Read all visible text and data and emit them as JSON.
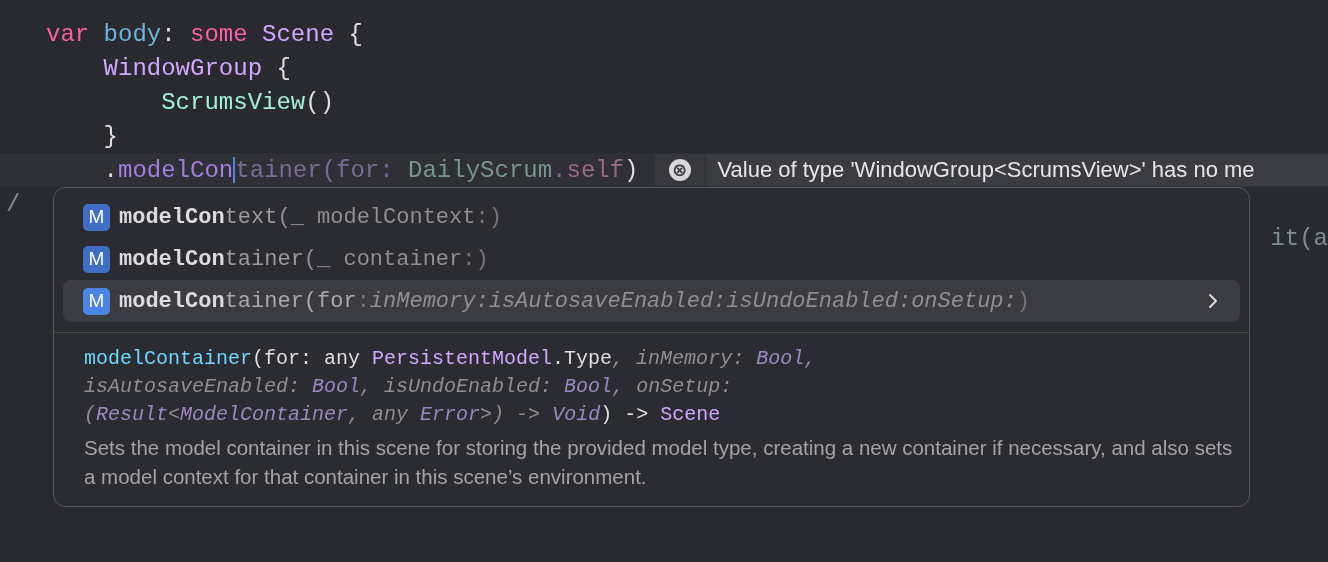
{
  "code_lines": [
    {
      "current": false,
      "tokens": [
        {
          "text": "var ",
          "kind": "keyword"
        },
        {
          "text": "body",
          "kind": "declaration"
        },
        {
          "text": ": ",
          "kind": "plain"
        },
        {
          "text": "some ",
          "kind": "keyword"
        },
        {
          "text": "Scene",
          "kind": "type"
        },
        {
          "text": " {",
          "kind": "plain"
        }
      ]
    },
    {
      "current": false,
      "tokens": [
        {
          "text": "    WindowGroup",
          "kind": "type"
        },
        {
          "text": " {",
          "kind": "plain"
        }
      ]
    },
    {
      "current": false,
      "tokens": [
        {
          "text": "        ScrumsView",
          "kind": "project-type"
        },
        {
          "text": "()",
          "kind": "plain"
        }
      ]
    },
    {
      "current": false,
      "tokens": [
        {
          "text": "    }",
          "kind": "plain"
        }
      ]
    },
    {
      "current": true,
      "tokens": [
        {
          "text": "    .",
          "kind": "plain"
        },
        {
          "text": "modelCon",
          "kind": "member",
          "cursor_after": true
        },
        {
          "text": "tainer(for: ",
          "kind": "ghost"
        },
        {
          "text": "DailyScrum",
          "kind": "ghost-type"
        },
        {
          "text": ".",
          "kind": "ghost"
        },
        {
          "text": "self",
          "kind": "ghost-keyword"
        },
        {
          "text": ")",
          "kind": "plain"
        }
      ],
      "error": {
        "icon": "⊗",
        "message": "Value of type 'WindowGroup<ScrumsView>' has no me"
      }
    },
    {
      "current": false,
      "kind": "left-fragment",
      "tokens": [
        {
          "text": "/",
          "kind": "comment"
        }
      ]
    },
    {
      "current": false,
      "kind": "right-fragment",
      "tokens": [
        {
          "text": "it(a",
          "kind": "comment"
        }
      ]
    }
  ],
  "completions": {
    "items": [
      {
        "icon": "M",
        "selected": false,
        "match": "modelCon",
        "rest": "text",
        "signature": [
          {
            "text": "(_ modelContext",
            "kind": "param"
          },
          {
            "text": ":)",
            "kind": "punct"
          }
        ]
      },
      {
        "icon": "M",
        "selected": false,
        "match": "modelCon",
        "rest": "tainer",
        "signature": [
          {
            "text": "(_ container",
            "kind": "param"
          },
          {
            "text": ":)",
            "kind": "punct"
          }
        ]
      },
      {
        "icon": "M",
        "selected": true,
        "match": "modelCon",
        "rest": "tainer",
        "signature": [
          {
            "text": "(for",
            "kind": "param"
          },
          {
            "text": ":",
            "kind": "punct"
          },
          {
            "text": "inMemory:isAutosaveEnabled:isUndoEnabled:onSetup:",
            "kind": "italic"
          },
          {
            "text": ")",
            "kind": "punct"
          }
        ]
      }
    ],
    "detail": {
      "declaration": [
        {
          "text": "modelContainer",
          "kind": "func"
        },
        {
          "text": "(for: any ",
          "kind": "plain"
        },
        {
          "text": "PersistentModel",
          "kind": "type"
        },
        {
          "text": ".Type",
          "kind": "plain"
        },
        {
          "text": ", inMemory: ",
          "kind": "dim"
        },
        {
          "text": "Bool",
          "kind": "dim-type"
        },
        {
          "text": ",\nisAutosaveEnabled: ",
          "kind": "dim"
        },
        {
          "text": "Bool",
          "kind": "dim-type"
        },
        {
          "text": ", isUndoEnabled: ",
          "kind": "dim"
        },
        {
          "text": "Bool",
          "kind": "dim-type"
        },
        {
          "text": ", onSetup:\n(",
          "kind": "dim"
        },
        {
          "text": "Result",
          "kind": "dim-type"
        },
        {
          "text": "<",
          "kind": "dim"
        },
        {
          "text": "ModelContainer",
          "kind": "dim-type"
        },
        {
          "text": ", any ",
          "kind": "dim"
        },
        {
          "text": "Error",
          "kind": "dim-type"
        },
        {
          "text": ">) -> ",
          "kind": "dim"
        },
        {
          "text": "Void",
          "kind": "dim-type"
        },
        {
          "text": ") -> ",
          "kind": "plain"
        },
        {
          "text": "Scene",
          "kind": "type"
        }
      ],
      "description": "Sets the model container in this scene for storing the provided model type, creating a new container if necessary, and also sets a model context for that container in this scene’s environment."
    }
  }
}
